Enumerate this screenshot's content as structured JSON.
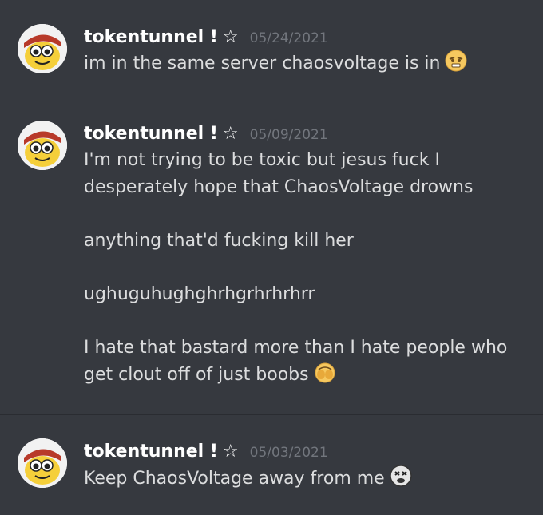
{
  "messages": [
    {
      "username": "tokentunnel !",
      "star_icon": "star-outline-icon",
      "timestamp": "05/24/2021",
      "lines": [
        "im in the same server chaosvoltage is in"
      ],
      "emoji": "orange-face-emoji"
    },
    {
      "username": "tokentunnel !",
      "star_icon": "star-outline-icon",
      "timestamp": "05/09/2021",
      "lines": [
        "I'm not trying to be toxic but jesus fuck I",
        "desperately hope that ChaosVoltage drowns",
        "",
        "anything that'd fucking kill her",
        "",
        "ughuguhughghrhgrhrhrhrr",
        "",
        "I hate that bastard more than I hate people who",
        "get clout off of just boobs"
      ],
      "emoji": "covering-face-emoji"
    },
    {
      "username": "tokentunnel !",
      "star_icon": "star-outline-icon",
      "timestamp": "05/03/2021",
      "lines": [
        "Keep ChaosVoltage away from me"
      ],
      "emoji": "dead-face-emoji"
    }
  ],
  "colors": {
    "background": "#36393f",
    "username": "#ffffff",
    "timestamp": "#72767d",
    "text": "#dcddde",
    "divider": "#2a2c31"
  }
}
